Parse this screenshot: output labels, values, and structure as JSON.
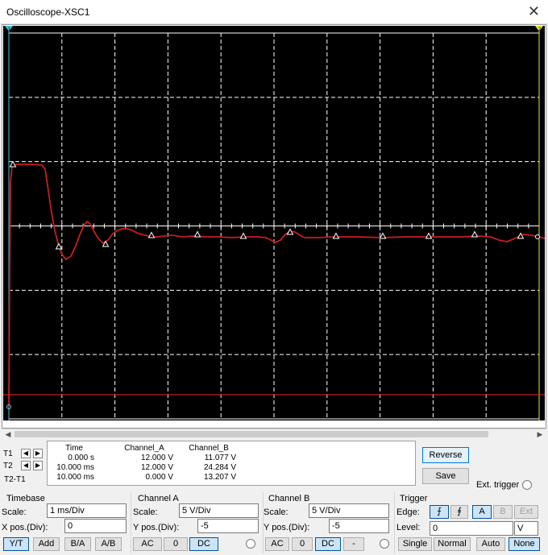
{
  "window": {
    "title": "Oscilloscope-XSC1",
    "close_glyph": "✕"
  },
  "screen": {
    "background": "#000000",
    "grid_color": "#ffffff",
    "trace_color": "#c81e1e",
    "cursor1_color": "#3cc8dc",
    "cursor2_color": "#e6e632",
    "cursor1_label": "1",
    "cursor2_label": "2"
  },
  "cursors": {
    "t1": "T1",
    "t2": "T2",
    "t2t1": "T2-T1",
    "left_arrow": "◀",
    "right_arrow": "▶"
  },
  "measurements": {
    "headers": [
      "Time",
      "Channel_A",
      "Channel_B"
    ],
    "rows": [
      [
        "0.000 s",
        "12.000 V",
        "11.077 V"
      ],
      [
        "10.000 ms",
        "12.000 V",
        "24.284 V"
      ],
      [
        "10.000 ms",
        "0.000 V",
        "13.207 V"
      ]
    ]
  },
  "buttons": {
    "reverse": "Reverse",
    "save": "Save",
    "ext_trigger": "Ext. trigger"
  },
  "timebase": {
    "title": "Timebase",
    "scale_label": "Scale:",
    "scale": "1 ms/Div",
    "xpos_label": "X pos.(Div):",
    "xpos": "0",
    "modes": [
      "Y/T",
      "Add",
      "B/A",
      "A/B"
    ]
  },
  "channel_a": {
    "title": "Channel A",
    "scale_label": "Scale:",
    "scale": "5  V/Div",
    "ypos_label": "Y pos.(Div):",
    "ypos": "-5",
    "coupling": [
      "AC",
      "0",
      "DC"
    ]
  },
  "channel_b": {
    "title": "Channel B",
    "scale_label": "Scale:",
    "scale": "5  V/Div",
    "ypos_label": "Y pos.(Div):",
    "ypos": "-5",
    "coupling": [
      "AC",
      "0",
      "DC",
      "-"
    ]
  },
  "trigger": {
    "title": "Trigger",
    "edge_label": "Edge:",
    "edge_rise": "⨍",
    "edge_fall": "⨎",
    "sources": [
      "A",
      "B",
      "Ext"
    ],
    "level_label": "Level:",
    "level": "0",
    "level_unit": "V",
    "modes": [
      "Single",
      "Normal",
      "Auto",
      "None"
    ]
  }
}
